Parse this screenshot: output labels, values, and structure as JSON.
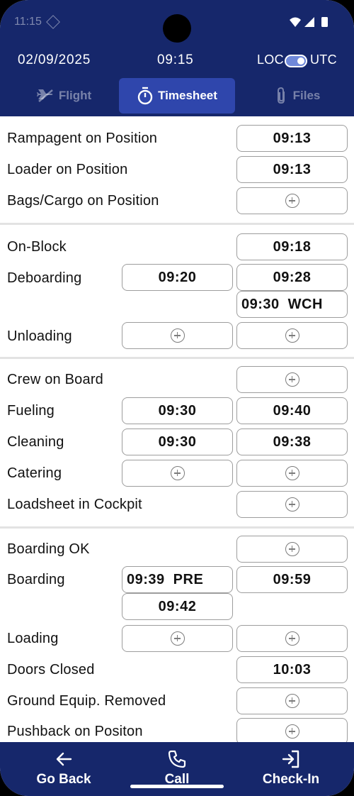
{
  "status_bar": {
    "time": "11:15",
    "icons": [
      "dnd-icon",
      "wifi-icon",
      "signal-icon",
      "battery-icon"
    ]
  },
  "header": {
    "date": "02/09/2025",
    "time": "09:15",
    "loc_label": "LOC",
    "utc_label": "UTC",
    "utc_toggle_on": true
  },
  "tabs": [
    {
      "label": "Flight",
      "icon": "plane-icon",
      "active": false
    },
    {
      "label": "Timesheet",
      "icon": "stopwatch-icon",
      "active": true
    },
    {
      "label": "Files",
      "icon": "paperclip-icon",
      "active": false
    }
  ],
  "sections": [
    {
      "rows": [
        {
          "label": "Rampagent on Position",
          "end": "09:13"
        },
        {
          "label": "Loader on Position",
          "end": "09:13"
        },
        {
          "label": "Bags/Cargo on Position",
          "end": null
        }
      ]
    },
    {
      "rows": [
        {
          "label": "On-Block",
          "end": "09:18"
        },
        {
          "label": "Deboarding",
          "start": "09:20",
          "end": "09:28",
          "end_extra_time": "09:30",
          "end_extra_tag": "WCH"
        },
        {
          "label": "Unloading",
          "start": null,
          "end": null
        }
      ]
    },
    {
      "rows": [
        {
          "label": "Crew on Board",
          "end": null
        },
        {
          "label": "Fueling",
          "start": "09:30",
          "end": "09:40"
        },
        {
          "label": "Cleaning",
          "start": "09:30",
          "end": "09:38"
        },
        {
          "label": "Catering",
          "start": null,
          "end": null
        },
        {
          "label": "Loadsheet in Cockpit",
          "end": null
        }
      ]
    },
    {
      "rows": [
        {
          "label": "Boarding OK",
          "end": null
        },
        {
          "label": "Boarding",
          "start_time": "09:39",
          "start_tag": "PRE",
          "start_extra": "09:42",
          "end": "09:59"
        },
        {
          "label": "Loading",
          "start": null,
          "end": null
        },
        {
          "label": "Doors Closed",
          "end": "10:03"
        },
        {
          "label": "Ground Equip. Removed",
          "end": null
        },
        {
          "label": "Pushback on Positon",
          "end": null
        }
      ]
    }
  ],
  "bottom_nav": {
    "back_label": "Go Back",
    "call_label": "Call",
    "checkin_label": "Check-In"
  },
  "colors": {
    "header_bg": "#16276b",
    "active_tab_bg": "#2f46ac",
    "box_border": "#9d9d9d"
  }
}
